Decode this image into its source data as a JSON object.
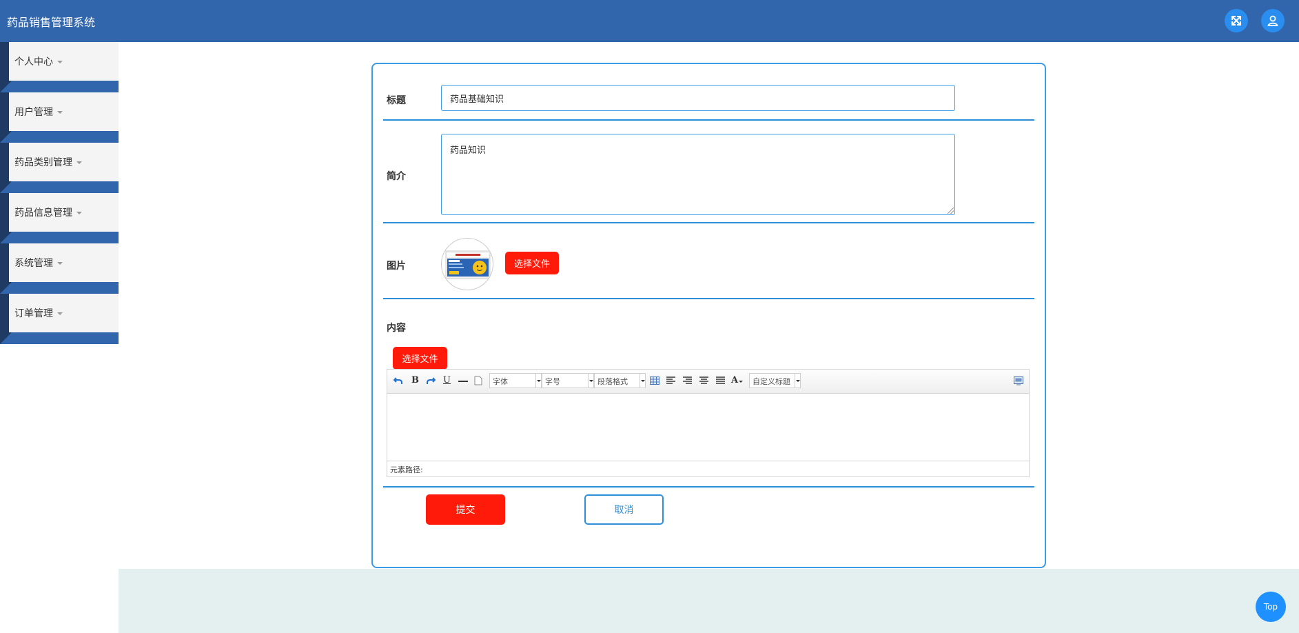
{
  "app": {
    "title": "药品销售管理系统"
  },
  "header": {
    "fullscreen_icon": "fullscreen-icon",
    "user_icon": "user-icon"
  },
  "sidebar": {
    "items": [
      {
        "label": "个人中心"
      },
      {
        "label": "用户管理"
      },
      {
        "label": "药品类别管理"
      },
      {
        "label": "药品信息管理"
      },
      {
        "label": "系统管理"
      },
      {
        "label": "订单管理"
      }
    ]
  },
  "form": {
    "title_label": "标题",
    "title_value": "药品基础知识",
    "intro_label": "简介",
    "intro_value": "药品知识",
    "image_label": "图片",
    "image_upload_button": "选择文件",
    "content_label": "内容",
    "content_upload_button": "选择文件",
    "submit_label": "提交",
    "cancel_label": "取消"
  },
  "editor": {
    "font_select": "字体",
    "size_select": "字号",
    "paragraph_select": "段落格式",
    "custom_title_select": "自定义标题",
    "status_text": "元素路径:",
    "bold": "B",
    "underline": "U",
    "font_color": "A"
  },
  "back_to_top": "Top",
  "colors": {
    "header_bg": "#3166ad",
    "accent_blue": "#2e8fd8",
    "red_button": "#ff1a0a",
    "footer_bg": "#e4f0ef"
  }
}
